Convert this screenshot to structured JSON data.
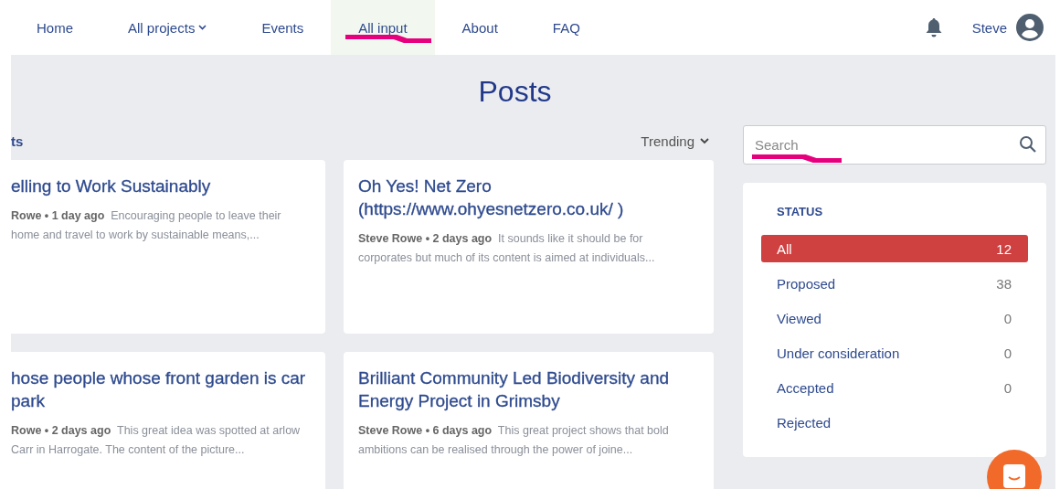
{
  "nav": {
    "items": [
      {
        "label": "Home",
        "dropdown": false,
        "selected": false
      },
      {
        "label": "All projects",
        "dropdown": true,
        "selected": false
      },
      {
        "label": "Events",
        "dropdown": false,
        "selected": false
      },
      {
        "label": "All input",
        "dropdown": false,
        "selected": true
      },
      {
        "label": "About",
        "dropdown": false,
        "selected": false
      },
      {
        "label": "FAQ",
        "dropdown": false,
        "selected": false
      }
    ],
    "user": "Steve"
  },
  "page_title": "Posts",
  "view_label": "ts",
  "sort": "Trending",
  "posts": [
    {
      "title": "elling to Work Sustainably",
      "meta": "Rowe • 1 day ago",
      "excerpt": "Encouraging people to leave their home and travel to work by sustainable means,...",
      "cut": true
    },
    {
      "title": "Oh Yes! Net Zero (https://www.ohyesnetzero.co.uk/ )",
      "meta": "Steve Rowe • 2 days ago",
      "excerpt": "It sounds like it should be for corporates but much of its content is aimed at individuals...",
      "cut": false
    },
    {
      "title": "hose people whose front garden is car park",
      "meta": "Rowe • 2 days ago",
      "excerpt": "This great idea was spotted at arlow Carr in Harrogate. The content of the picture...",
      "cut": true
    },
    {
      "title": "Brilliant Community Led Biodiversity and Energy Project in Grimsby",
      "meta": "Steve Rowe • 6 days ago",
      "excerpt": "This great project shows that bold ambitions can be realised through the power of joine...",
      "cut": false
    }
  ],
  "search": {
    "placeholder": "Search"
  },
  "status_filter": {
    "heading": "STATUS",
    "items": [
      {
        "label": "All",
        "count": "12",
        "selected": true
      },
      {
        "label": "Proposed",
        "count": "38",
        "selected": false
      },
      {
        "label": "Viewed",
        "count": "0",
        "selected": false
      },
      {
        "label": "Under consideration",
        "count": "0",
        "selected": false
      },
      {
        "label": "Accepted",
        "count": "0",
        "selected": false
      },
      {
        "label": "Rejected",
        "selected": false
      }
    ]
  }
}
